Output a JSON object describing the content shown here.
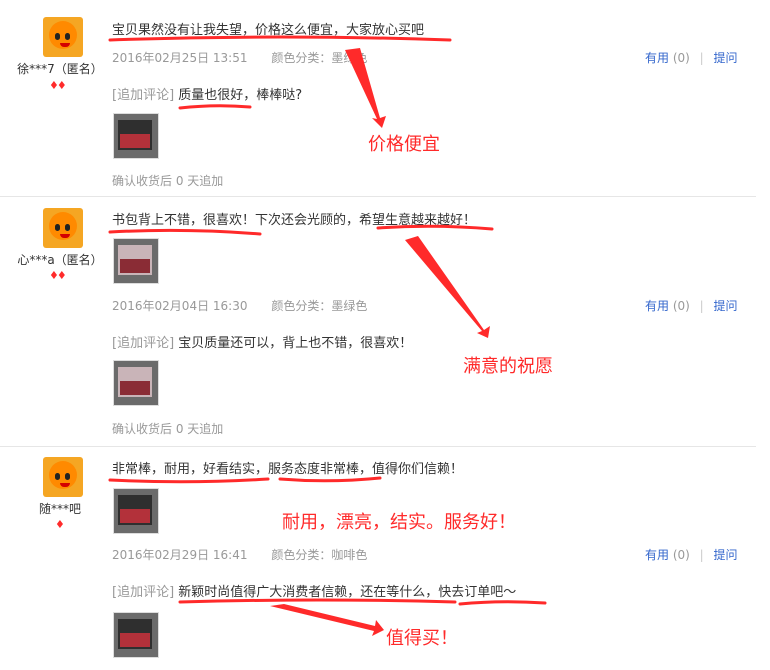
{
  "useful_label": "有用",
  "reply_label": "提问",
  "append_tag": "[追加评论]",
  "reviews": [
    {
      "user": "徐***7（匿名）",
      "hearts": "💎💎",
      "comment": "宝贝果然没有让我失望，价格这么便宜，大家放心买吧",
      "date": "2016年02月25日 13:51",
      "color": "颜色分类：墨绿色",
      "useful_count": "(0)",
      "append": "质量也很好，棒棒哒?",
      "confirm": "确认收货后 0 天追加"
    },
    {
      "user": "心***a（匿名）",
      "hearts": "💎💎",
      "comment": "书包背上不错，很喜欢！下次还会光顾的，希望生意越来越好！",
      "date": "2016年02月04日 16:30",
      "color": "颜色分类：墨绿色",
      "useful_count": "(0)",
      "append": "宝贝质量还可以，背上也不错，很喜欢！",
      "confirm": "确认收货后 0 天追加"
    },
    {
      "user": "随***吧",
      "hearts": "💎",
      "comment": "非常棒，耐用，好看结实，服务态度非常棒，值得你们信赖！",
      "date": "2016年02月29日 16:41",
      "color": "颜色分类：咖啡色",
      "useful_count": "(0)",
      "append": "新颖时尚值得广大消费者信赖，还在等什么，快去订单吧～"
    }
  ],
  "annotations": {
    "a1": "价格便宜",
    "a2": "满意的祝愿",
    "a3": "耐用，漂亮，结实。服务好！",
    "a4": "值得买！"
  },
  "colors": {
    "annotation": "#ff2a2a",
    "link": "#3366cc",
    "meta": "#999999"
  }
}
